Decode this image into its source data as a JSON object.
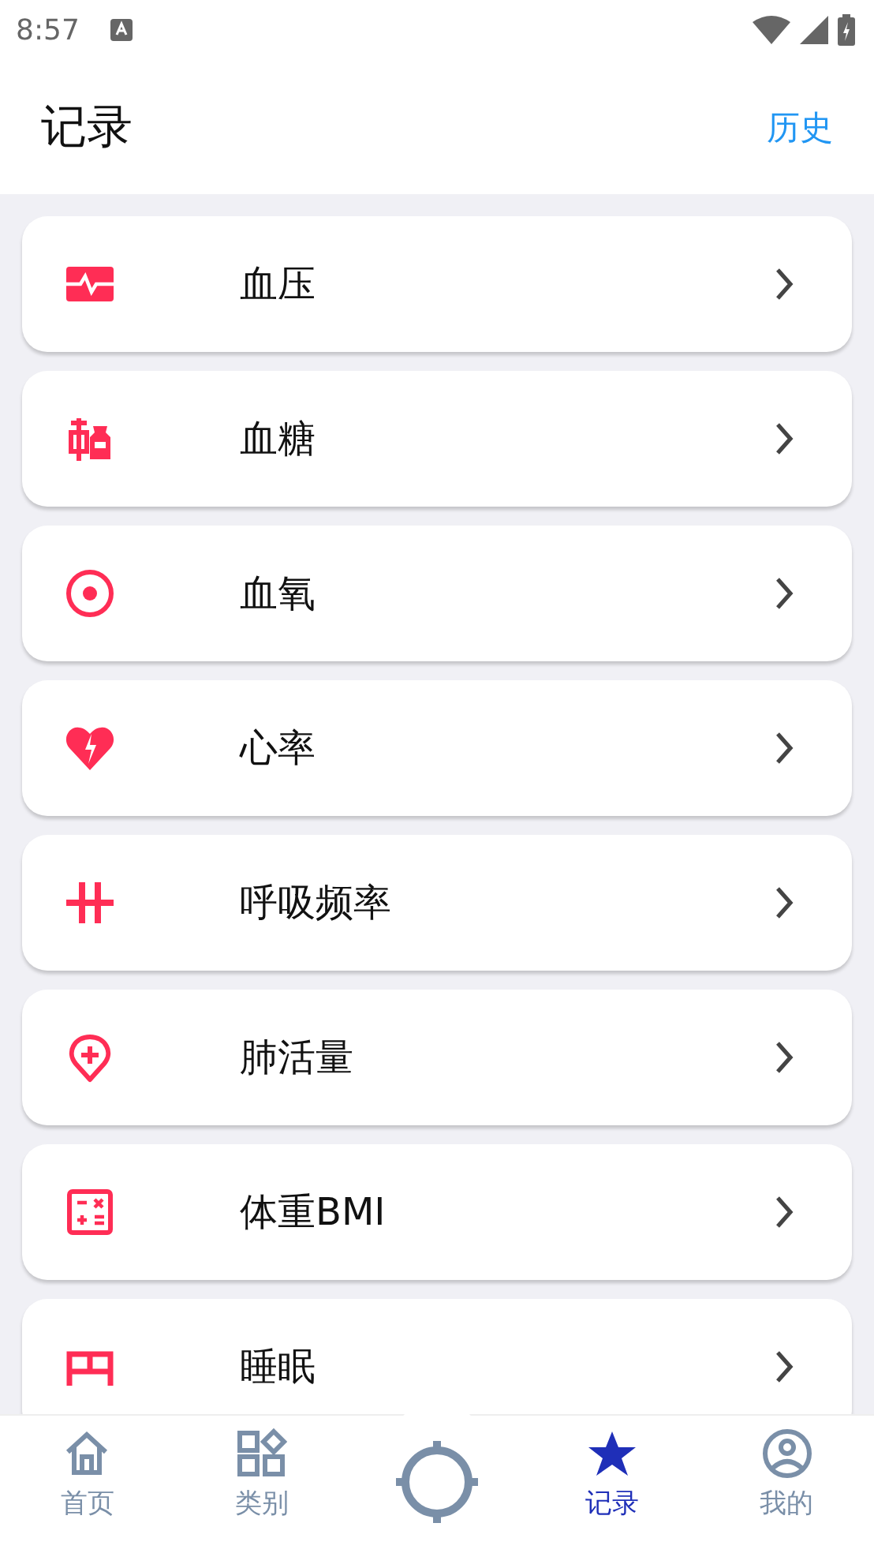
{
  "status_bar": {
    "time": "8:57"
  },
  "header": {
    "title": "记录",
    "action": "历史"
  },
  "records": [
    {
      "kind": "pulse",
      "label": "血压"
    },
    {
      "kind": "syringe",
      "label": "血糖"
    },
    {
      "kind": "target",
      "label": "血氧"
    },
    {
      "kind": "heart",
      "label": "心率"
    },
    {
      "kind": "bars",
      "label": "呼吸频率"
    },
    {
      "kind": "pin",
      "label": "肺活量"
    },
    {
      "kind": "calc",
      "label": "体重BMI"
    },
    {
      "kind": "bed",
      "label": "睡眠"
    }
  ],
  "bottom_nav": [
    {
      "kind": "home",
      "label": "首页",
      "selected": false
    },
    {
      "kind": "grid",
      "label": "类别",
      "selected": false
    },
    {
      "kind": "star",
      "label": "记录",
      "selected": true
    },
    {
      "kind": "user",
      "label": "我的",
      "selected": false
    }
  ]
}
